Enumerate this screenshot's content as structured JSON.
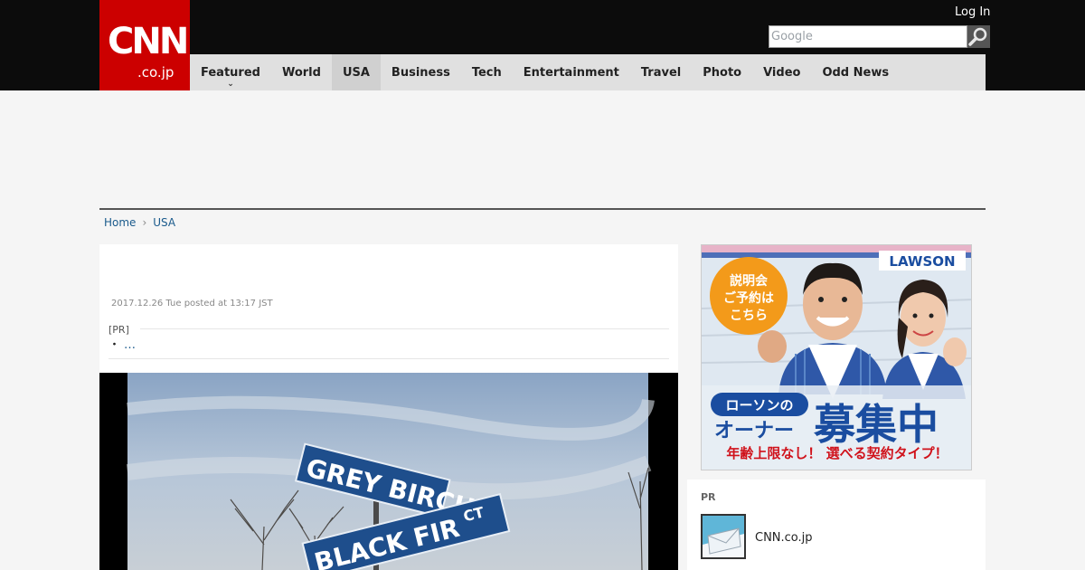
{
  "header": {
    "logo_main": "CNN",
    "logo_sub": ".co.jp",
    "login_label": "Log In",
    "search_placeholder": "Google"
  },
  "nav": {
    "items": [
      {
        "label": "Featured",
        "has_dropdown": true
      },
      {
        "label": "World"
      },
      {
        "label": "USA",
        "active": true
      },
      {
        "label": "Business"
      },
      {
        "label": "Tech"
      },
      {
        "label": "Entertainment"
      },
      {
        "label": "Travel"
      },
      {
        "label": "Photo"
      },
      {
        "label": "Video"
      },
      {
        "label": "Odd News"
      }
    ]
  },
  "breadcrumb": {
    "home": "Home",
    "current": "USA"
  },
  "article": {
    "posted": "2017.12.26 Tue posted at 13:17 JST",
    "pr_label": "[PR]",
    "pr_link": "…",
    "photo_signs": {
      "top": "GREY BIRCH",
      "bottom": "BLACK FIR",
      "bottom_suffix": "CT"
    }
  },
  "sidebar": {
    "ad": {
      "brand": "LAWSON",
      "bubble_lines": [
        "説明会",
        "ご予約は",
        "こちら"
      ],
      "tag": "ローソンの",
      "sub_left": "オーナー",
      "headline": "募集中",
      "tagline": "年齢上限なし！ 選べる契約タイプ！"
    },
    "pr": {
      "title": "PR",
      "item_name": "CNN.co.jp"
    }
  },
  "colors": {
    "brand_red": "#cc0000",
    "topbar": "#0c0c0c",
    "nav_bg": "#e0e0e0",
    "link": "#1a5a8c",
    "lawson_blue": "#1a4da0"
  }
}
